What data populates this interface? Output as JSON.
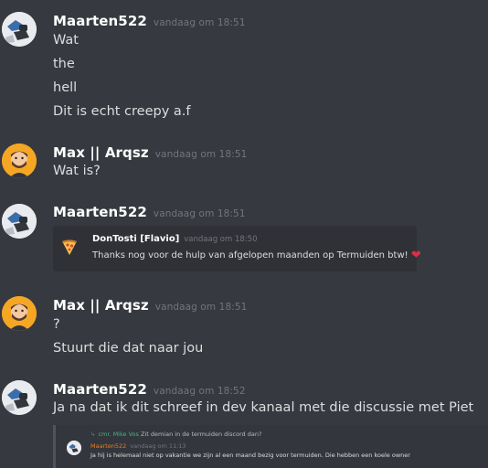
{
  "messages": [
    {
      "author": "Maarten522",
      "timestamp": "vandaag om 18:51",
      "lines": [
        "Wat",
        "the",
        "hell",
        "Dit is echt creepy a.f"
      ]
    },
    {
      "author": "Max || Arqsz",
      "timestamp": "vandaag om 18:51",
      "lines": [
        "Wat is?"
      ]
    },
    {
      "author": "Maarten522",
      "timestamp": "vandaag om 18:51",
      "embed": {
        "author": "DonTosti [Flavio]",
        "timestamp": "vandaag om 18:50",
        "text": "Thanks nog voor de hulp van afgelopen maanden op Termuiden btw!"
      }
    },
    {
      "author": "Max || Arqsz",
      "timestamp": "vandaag om 18:51",
      "lines": [
        "?",
        "Stuurt die dat naar jou"
      ]
    },
    {
      "author": "Maarten522",
      "timestamp": "vandaag om 18:52",
      "lines": [
        "Ja na dat ik dit schreef in dev kanaal met die discussie met Piet"
      ],
      "quote": {
        "reply_author": "cmr. Mike Vos",
        "reply_text": "Zit demian in de termuiden discord dan?",
        "author": "Maarten522",
        "timestamp": "vandaag om 11:13",
        "text": "Ja hij is helemaal niet op vakantie we zijn al een maand bezig voor termuiden. Die hebben een koele owner"
      }
    }
  ],
  "colors": {
    "background": "#36393f",
    "username": "#ffffff",
    "timestamp": "#72767d",
    "text": "#dcddde",
    "embed_bg": "#2f3136",
    "heart": "#dd2e44"
  }
}
